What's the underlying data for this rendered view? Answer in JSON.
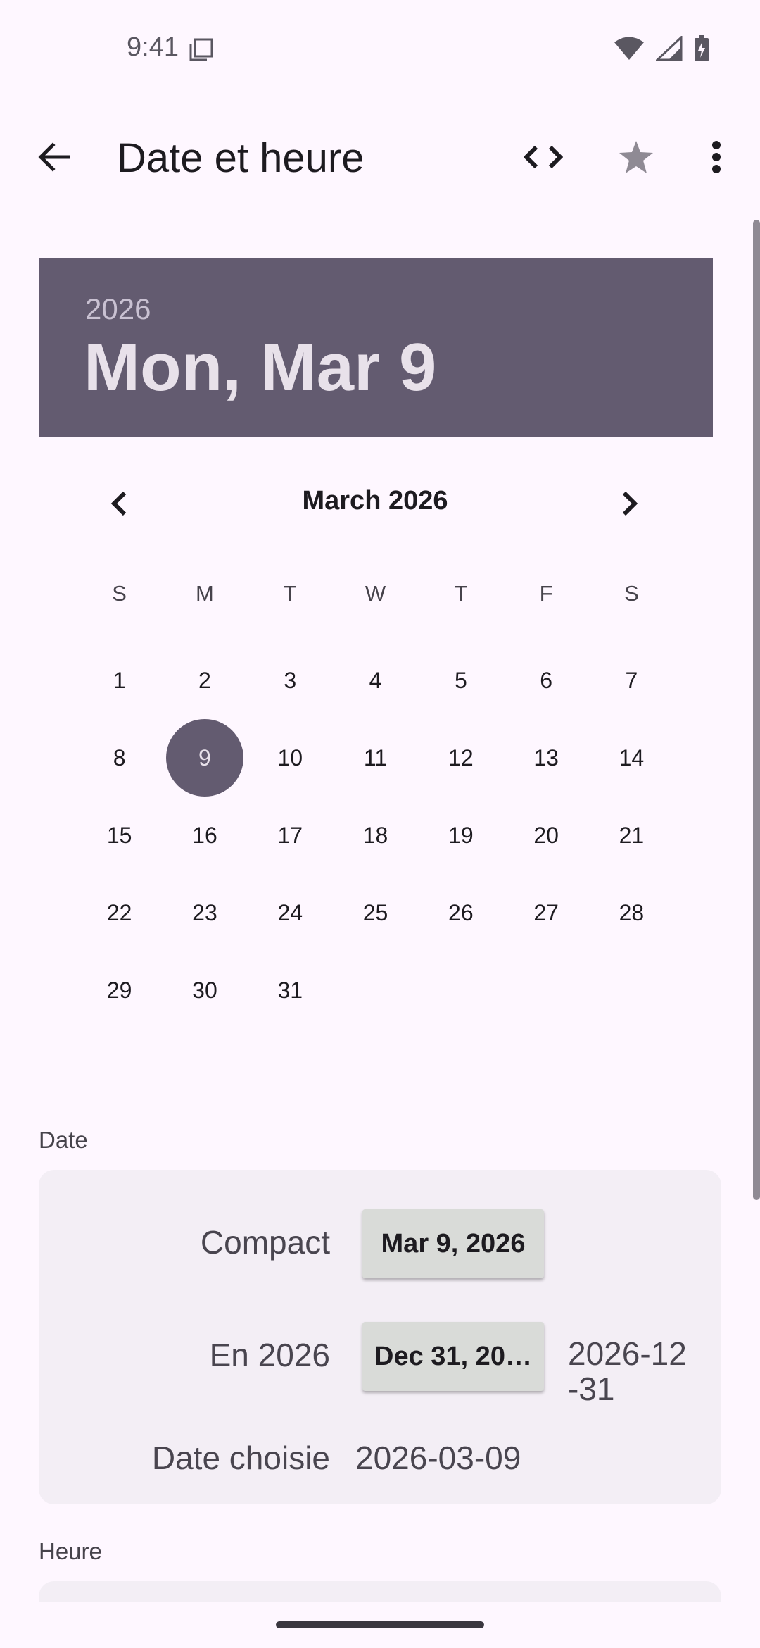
{
  "status_bar": {
    "time": "9:41",
    "icons": [
      "notification-copy-icon",
      "wifi-icon",
      "signal-icon",
      "battery-icon"
    ]
  },
  "app_bar": {
    "title": "Date et heure",
    "actions": [
      "back-arrow-icon",
      "code-icon",
      "star-icon",
      "more-vert-icon"
    ]
  },
  "date_picker": {
    "header_year": "2026",
    "header_date": "Mon, Mar 9",
    "month_label": "March 2026",
    "weekdays": [
      "S",
      "M",
      "T",
      "W",
      "T",
      "F",
      "S"
    ],
    "days": [
      "1",
      "2",
      "3",
      "4",
      "5",
      "6",
      "7",
      "8",
      "9",
      "10",
      "11",
      "12",
      "13",
      "14",
      "15",
      "16",
      "17",
      "18",
      "19",
      "20",
      "21",
      "22",
      "23",
      "24",
      "25",
      "26",
      "27",
      "28",
      "29",
      "30",
      "31"
    ],
    "selected_day": "9",
    "first_weekday_offset": 0
  },
  "date_section": {
    "label": "Date",
    "rows": {
      "compact_label": "Compact",
      "compact_button": "Mar 9, 2026",
      "year_label": "En 2026",
      "year_button": "Dec 31, 20…",
      "year_value_line1": "2026-12",
      "year_value_line2": "-31",
      "chosen_label": "Date choisie",
      "chosen_value": "2026-03-09"
    }
  },
  "time_section": {
    "label": "Heure"
  },
  "colors": {
    "background": "#fef7ff",
    "primary": "#635b70",
    "card": "#f3eef5",
    "button": "#d9dbd8"
  }
}
